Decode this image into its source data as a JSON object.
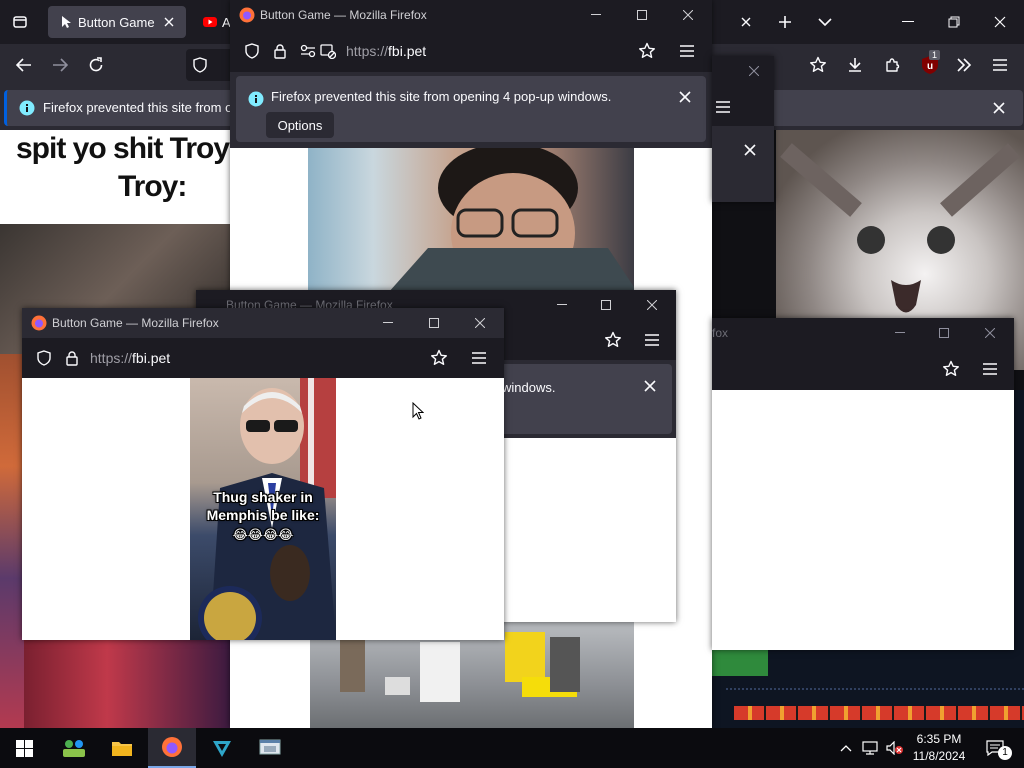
{
  "main_window": {
    "tabs": [
      {
        "title": "Button Game",
        "active": true
      },
      {
        "title": "A",
        "active": false
      }
    ],
    "notification": "Firefox prevented this site from opening 4 pop-up windows.",
    "notification_partial": "Firefox prevented this site from oper",
    "extension_badge": "1"
  },
  "popups": {
    "top": {
      "title": "Button Game — Mozilla Firefox",
      "url_scheme": "https://",
      "url_host": "fbi.pet",
      "notification": "Firefox prevented this site from opening 4 pop-up windows.",
      "options_label": "Options"
    },
    "left": {
      "title": "Button Game — Mozilla Firefox",
      "url_scheme": "https://",
      "url_host": "fbi.pet",
      "caption_line1": "Thug shaker in",
      "caption_line2": "Memphis be like:",
      "caption_emoji": "😂😂😂😂"
    },
    "middle": {
      "title": "Button Game — Mozilla Firefox",
      "notification_partial": "windows."
    },
    "right": {
      "title_partial": "fox"
    }
  },
  "page": {
    "meme_line1": "spit yo shit Troy",
    "meme_line2": "Troy:"
  },
  "taskbar": {
    "time": "6:35 PM",
    "date": "11/8/2024",
    "notification_count": "1"
  },
  "colors": {
    "accent": "#0060df",
    "info": "#80ebff",
    "chrome_dark": "#1c1b22",
    "chrome": "#2b2a33",
    "youtube_red": "#ff0000",
    "ublock_red": "#800000"
  }
}
